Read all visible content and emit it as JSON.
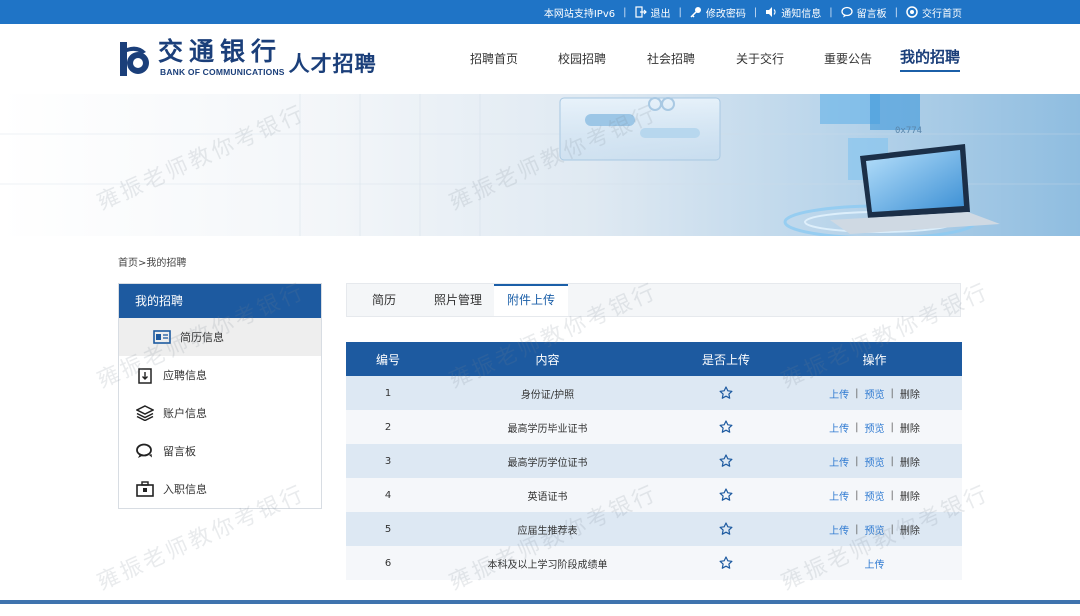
{
  "topbar": {
    "ipv6": "本网站支持IPv6",
    "logout": "退出",
    "change_password": "修改密码",
    "notice": "通知信息",
    "message_board": "留言板",
    "bank_home": "交行首页"
  },
  "header": {
    "logo_cn": "交通银行",
    "logo_en": "BANK OF COMMUNICATIONS",
    "logo_sub": "人才招聘",
    "nav": [
      "招聘首页",
      "校园招聘",
      "社会招聘",
      "关于交行",
      "重要公告",
      "我的招聘"
    ],
    "active_nav": "我的招聘"
  },
  "banner": {
    "screen_text": "0x774"
  },
  "breadcrumb": {
    "home": "首页",
    "separator": ">",
    "current": "我的招聘"
  },
  "sidebar": {
    "title": "我的招聘",
    "items": [
      {
        "label": "简历信息",
        "icon": "resume-icon",
        "active": true
      },
      {
        "label": "应聘信息",
        "icon": "application-icon",
        "active": false
      },
      {
        "label": "账户信息",
        "icon": "layers-icon",
        "active": false
      },
      {
        "label": "留言板",
        "icon": "chat-icon",
        "active": false
      },
      {
        "label": "入职信息",
        "icon": "briefcase-icon",
        "active": false
      }
    ]
  },
  "tabs": [
    {
      "label": "简历",
      "active": false
    },
    {
      "label": "照片管理",
      "active": false
    },
    {
      "label": "附件上传",
      "active": true
    }
  ],
  "table": {
    "headers": [
      "编号",
      "内容",
      "是否上传",
      "操作"
    ],
    "rows": [
      {
        "no": "1",
        "content": "身份证/护照",
        "uploaded_icon": "star-outline-icon",
        "upload": "上传",
        "preview": "预览",
        "delete": "删除"
      },
      {
        "no": "2",
        "content": "最高学历毕业证书",
        "uploaded_icon": "star-outline-icon",
        "upload": "上传",
        "preview": "预览",
        "delete": "删除"
      },
      {
        "no": "3",
        "content": "最高学历学位证书",
        "uploaded_icon": "star-outline-icon",
        "upload": "上传",
        "preview": "预览",
        "delete": "删除"
      },
      {
        "no": "4",
        "content": "英语证书",
        "uploaded_icon": "star-outline-icon",
        "upload": "上传",
        "preview": "预览",
        "delete": "删除"
      },
      {
        "no": "5",
        "content": "应届生推荐表",
        "uploaded_icon": "star-outline-icon",
        "upload": "上传",
        "preview": "预览",
        "delete": "删除"
      },
      {
        "no": "6",
        "content": "本科及以上学习阶段成绩单",
        "uploaded_icon": "star-outline-icon",
        "upload": "上传"
      }
    ]
  },
  "watermark": "雍振老师教你考银行",
  "colors": {
    "topbar": "#1f74c6",
    "primary": "#1d5aa0",
    "link": "#2f7ad1",
    "row_alt": "#dde8f3"
  }
}
